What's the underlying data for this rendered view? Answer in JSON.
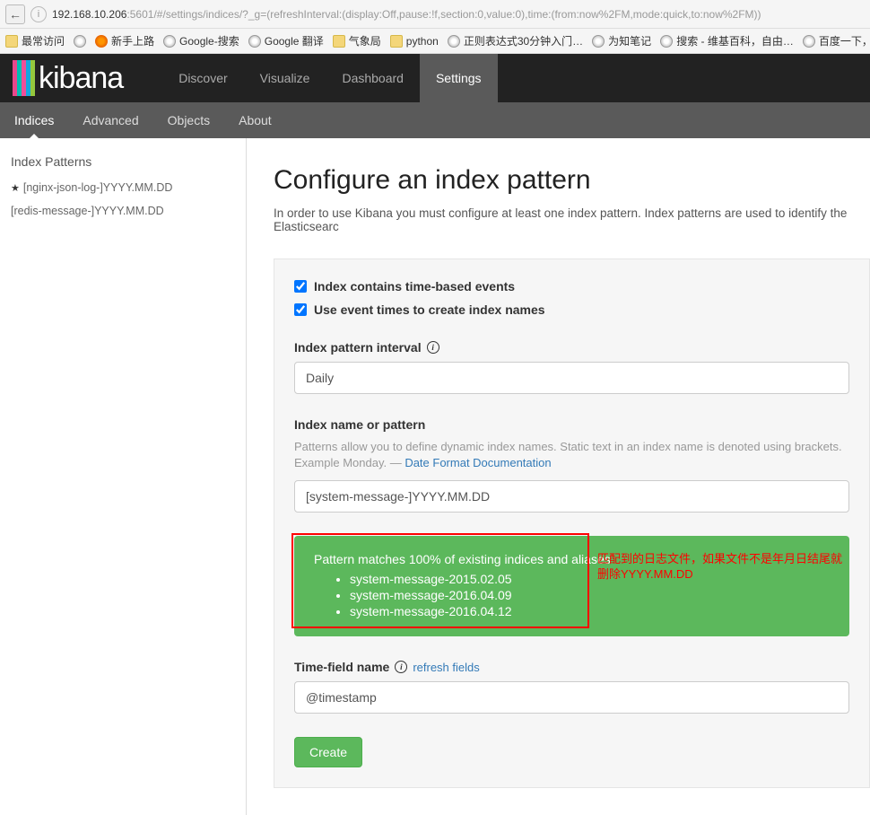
{
  "browser": {
    "url_host": "192.168.10.206",
    "url_port": ":5601",
    "url_path": "/#/settings/indices/?_g=(refreshInterval:(display:Off,pause:!f,section:0,value:0),time:(from:now%2FM,mode:quick,to:now%2FM))"
  },
  "bookmarks": [
    {
      "label": "最常访问",
      "icon": "folder"
    },
    {
      "label": "",
      "icon": "globe"
    },
    {
      "label": "新手上路",
      "icon": "firefox"
    },
    {
      "label": "Google-搜索",
      "icon": "globe"
    },
    {
      "label": "Google 翻译",
      "icon": "globe"
    },
    {
      "label": "气象局",
      "icon": "folder"
    },
    {
      "label": "python",
      "icon": "folder"
    },
    {
      "label": "正则表达式30分钟入门…",
      "icon": "globe"
    },
    {
      "label": "为知笔记",
      "icon": "globe"
    },
    {
      "label": "搜索 - 维基百科，自由…",
      "icon": "globe"
    },
    {
      "label": "百度一下，你",
      "icon": "globe"
    }
  ],
  "nav": {
    "items": [
      "Discover",
      "Visualize",
      "Dashboard",
      "Settings"
    ],
    "active": 3
  },
  "subnav": {
    "items": [
      "Indices",
      "Advanced",
      "Objects",
      "About"
    ],
    "active": 0
  },
  "sidebar": {
    "title": "Index Patterns",
    "patterns": [
      {
        "label": "[nginx-json-log-]YYYY.MM.DD",
        "default": true
      },
      {
        "label": "[redis-message-]YYYY.MM.DD",
        "default": false
      }
    ]
  },
  "page": {
    "title": "Configure an index pattern",
    "subtitle": "In order to use Kibana you must configure at least one index pattern. Index patterns are used to identify the Elasticsearc"
  },
  "form": {
    "checkbox1_label": "Index contains time-based events",
    "checkbox2_label": "Use event times to create index names",
    "interval_label": "Index pattern interval",
    "interval_value": "Daily",
    "name_label": "Index name or pattern",
    "name_help_prefix": "Patterns allow you to define dynamic index names. Static text in an index name is denoted using brackets. Example Monday. — ",
    "name_help_link": "Date Format Documentation",
    "name_value": "[system-message-]YYYY.MM.DD",
    "match_text": "Pattern matches 100% of existing indices and aliases",
    "match_items": [
      "system-message-2015.02.05",
      "system-message-2016.04.09",
      "system-message-2016.04.12"
    ],
    "red_note": "匹配到的日志文件，如果文件不是年月日结尾就删除YYYY.MM.DD",
    "timefield_label": "Time-field name",
    "timefield_refresh": "refresh fields",
    "timefield_value": "@timestamp",
    "create_label": "Create"
  }
}
